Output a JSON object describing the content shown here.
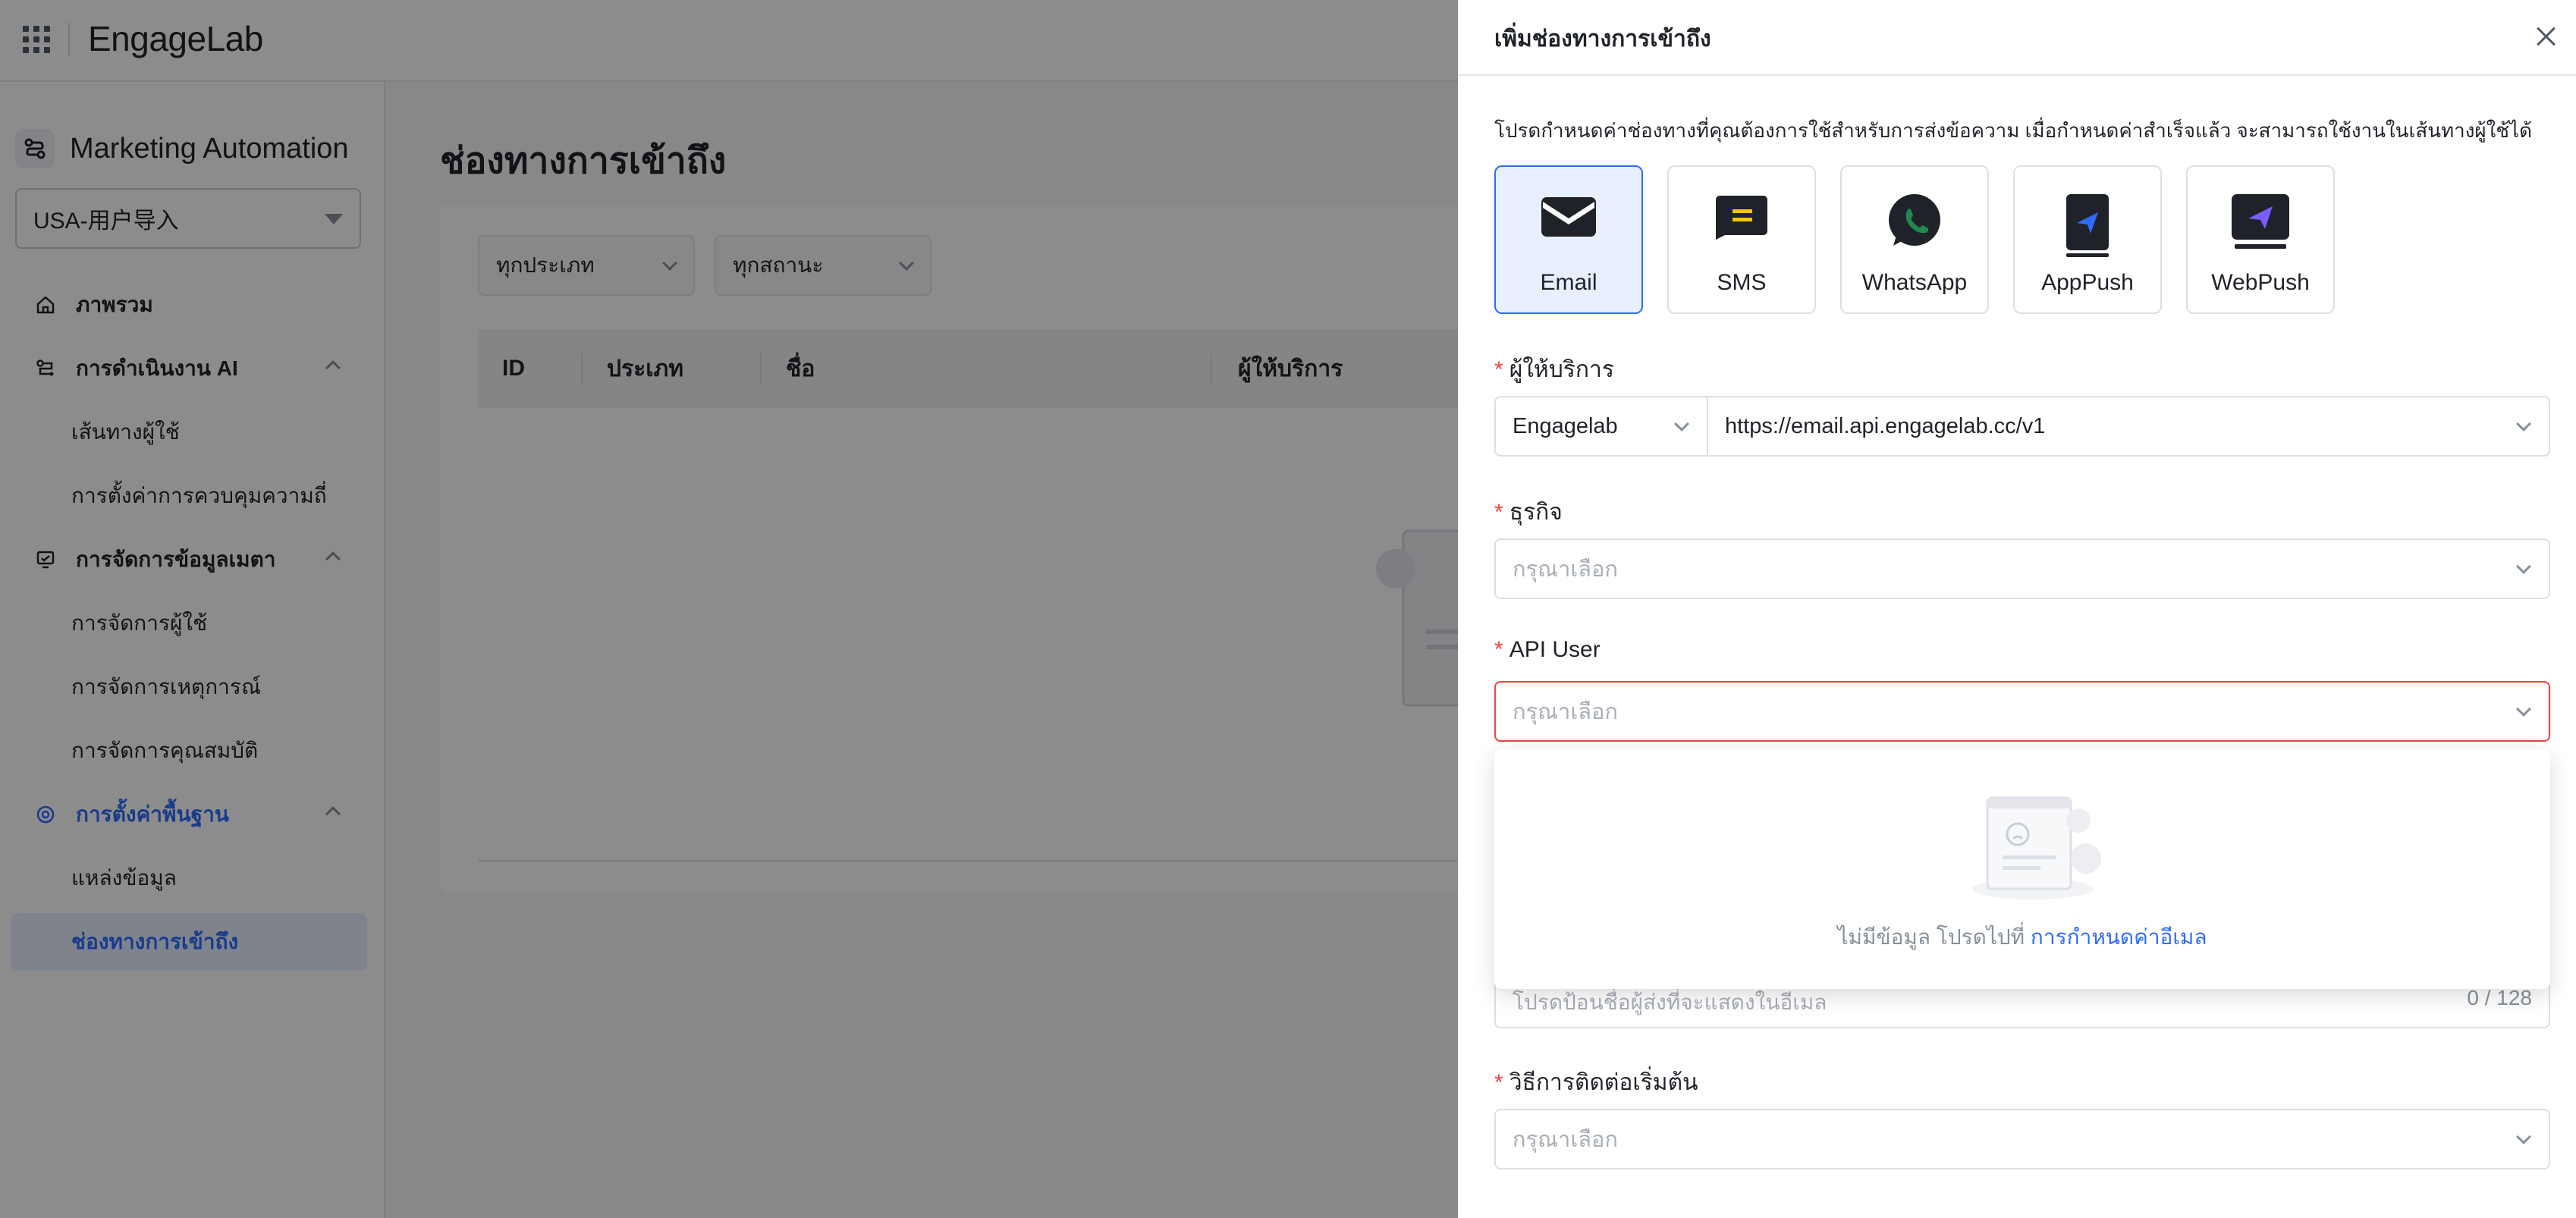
{
  "topbar": {
    "logo": "EngageLab"
  },
  "sidebar": {
    "app_title": "Marketing Automation",
    "project": "USA-用户导入",
    "items": [
      {
        "label": "ภาพรวม"
      },
      {
        "label": "การดำเนินงาน AI"
      },
      {
        "label": "เส้นทางผู้ใช้"
      },
      {
        "label": "การตั้งค่าการควบคุมความถี่"
      },
      {
        "label": "การจัดการข้อมูลเมตา"
      },
      {
        "label": "การจัดการผู้ใช้"
      },
      {
        "label": "การจัดการเหตุการณ์"
      },
      {
        "label": "การจัดการคุณสมบัติ"
      },
      {
        "label": "การตั้งค่าพื้นฐาน"
      },
      {
        "label": "แหล่งข้อมูล"
      },
      {
        "label": "ช่องทางการเข้าถึง"
      }
    ]
  },
  "main": {
    "title": "ช่องทางการเข้าถึง",
    "filters": {
      "type": "ทุกประเภท",
      "status": "ทุกสถานะ"
    },
    "columns": [
      "ID",
      "ประเภท",
      "ชื่อ",
      "ผู้ให้บริการ"
    ]
  },
  "drawer": {
    "title": "เพิ่มช่องทางการเข้าถึง",
    "intro": "โปรดกำหนดค่าช่องทางที่คุณต้องการใช้สำหรับการส่งข้อความ เมื่อกำหนดค่าสำเร็จแล้ว จะสามารถใช้งานในเส้นทางผู้ใช้ได้",
    "channels": [
      {
        "label": "Email",
        "icon": "envelope-icon",
        "selected": true
      },
      {
        "label": "SMS",
        "icon": "sms-icon"
      },
      {
        "label": "WhatsApp",
        "icon": "whatsapp-icon"
      },
      {
        "label": "AppPush",
        "icon": "app-push-icon"
      },
      {
        "label": "WebPush",
        "icon": "web-push-icon"
      }
    ],
    "provider": {
      "label": "ผู้ให้บริการ",
      "name": "Engagelab",
      "endpoint": "https://email.api.engagelab.cc/v1"
    },
    "business": {
      "label": "ธุรกิจ",
      "placeholder": "กรุณาเลือก"
    },
    "api_user": {
      "label": "API User",
      "placeholder": "กรุณาเลือก"
    },
    "dropdown": {
      "empty_text": "ไม่มีข้อมูล โปรดไปที่",
      "link_text": "การกำหนดค่าอีเมล"
    },
    "sender_name": {
      "placeholder": "โปรดป้อนชื่อผู้ส่งที่จะแสดงในอีเมล",
      "counter": "0 / 128"
    },
    "initial_contact": {
      "label": "วิธีการติดต่อเริ่มต้น",
      "placeholder": "กรุณาเลือก"
    }
  },
  "colors": {
    "accent": "#2f6bff",
    "error": "#f53f3f",
    "whatsapp": "#1f8a4c"
  }
}
